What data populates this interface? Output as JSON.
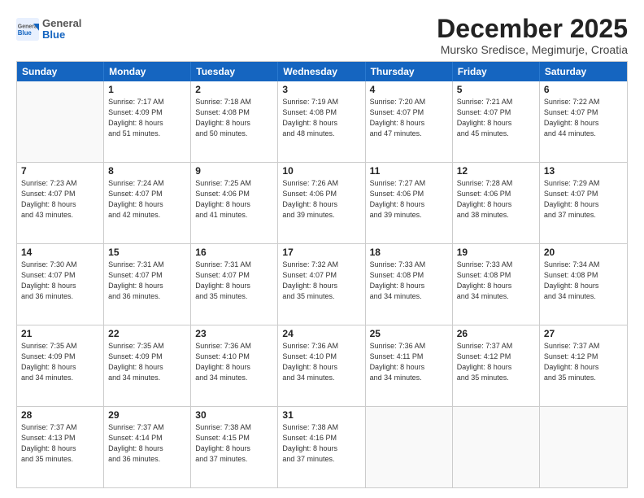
{
  "header": {
    "logo": {
      "general": "General",
      "blue": "Blue"
    },
    "title": "December 2025",
    "subtitle": "Mursko Sredisce, Megimurje, Croatia"
  },
  "calendar": {
    "days": [
      "Sunday",
      "Monday",
      "Tuesday",
      "Wednesday",
      "Thursday",
      "Friday",
      "Saturday"
    ],
    "rows": [
      [
        {
          "day": "",
          "info": ""
        },
        {
          "day": "1",
          "info": "Sunrise: 7:17 AM\nSunset: 4:09 PM\nDaylight: 8 hours\nand 51 minutes."
        },
        {
          "day": "2",
          "info": "Sunrise: 7:18 AM\nSunset: 4:08 PM\nDaylight: 8 hours\nand 50 minutes."
        },
        {
          "day": "3",
          "info": "Sunrise: 7:19 AM\nSunset: 4:08 PM\nDaylight: 8 hours\nand 48 minutes."
        },
        {
          "day": "4",
          "info": "Sunrise: 7:20 AM\nSunset: 4:07 PM\nDaylight: 8 hours\nand 47 minutes."
        },
        {
          "day": "5",
          "info": "Sunrise: 7:21 AM\nSunset: 4:07 PM\nDaylight: 8 hours\nand 45 minutes."
        },
        {
          "day": "6",
          "info": "Sunrise: 7:22 AM\nSunset: 4:07 PM\nDaylight: 8 hours\nand 44 minutes."
        }
      ],
      [
        {
          "day": "7",
          "info": "Sunrise: 7:23 AM\nSunset: 4:07 PM\nDaylight: 8 hours\nand 43 minutes."
        },
        {
          "day": "8",
          "info": "Sunrise: 7:24 AM\nSunset: 4:07 PM\nDaylight: 8 hours\nand 42 minutes."
        },
        {
          "day": "9",
          "info": "Sunrise: 7:25 AM\nSunset: 4:06 PM\nDaylight: 8 hours\nand 41 minutes."
        },
        {
          "day": "10",
          "info": "Sunrise: 7:26 AM\nSunset: 4:06 PM\nDaylight: 8 hours\nand 39 minutes."
        },
        {
          "day": "11",
          "info": "Sunrise: 7:27 AM\nSunset: 4:06 PM\nDaylight: 8 hours\nand 39 minutes."
        },
        {
          "day": "12",
          "info": "Sunrise: 7:28 AM\nSunset: 4:06 PM\nDaylight: 8 hours\nand 38 minutes."
        },
        {
          "day": "13",
          "info": "Sunrise: 7:29 AM\nSunset: 4:07 PM\nDaylight: 8 hours\nand 37 minutes."
        }
      ],
      [
        {
          "day": "14",
          "info": "Sunrise: 7:30 AM\nSunset: 4:07 PM\nDaylight: 8 hours\nand 36 minutes."
        },
        {
          "day": "15",
          "info": "Sunrise: 7:31 AM\nSunset: 4:07 PM\nDaylight: 8 hours\nand 36 minutes."
        },
        {
          "day": "16",
          "info": "Sunrise: 7:31 AM\nSunset: 4:07 PM\nDaylight: 8 hours\nand 35 minutes."
        },
        {
          "day": "17",
          "info": "Sunrise: 7:32 AM\nSunset: 4:07 PM\nDaylight: 8 hours\nand 35 minutes."
        },
        {
          "day": "18",
          "info": "Sunrise: 7:33 AM\nSunset: 4:08 PM\nDaylight: 8 hours\nand 34 minutes."
        },
        {
          "day": "19",
          "info": "Sunrise: 7:33 AM\nSunset: 4:08 PM\nDaylight: 8 hours\nand 34 minutes."
        },
        {
          "day": "20",
          "info": "Sunrise: 7:34 AM\nSunset: 4:08 PM\nDaylight: 8 hours\nand 34 minutes."
        }
      ],
      [
        {
          "day": "21",
          "info": "Sunrise: 7:35 AM\nSunset: 4:09 PM\nDaylight: 8 hours\nand 34 minutes."
        },
        {
          "day": "22",
          "info": "Sunrise: 7:35 AM\nSunset: 4:09 PM\nDaylight: 8 hours\nand 34 minutes."
        },
        {
          "day": "23",
          "info": "Sunrise: 7:36 AM\nSunset: 4:10 PM\nDaylight: 8 hours\nand 34 minutes."
        },
        {
          "day": "24",
          "info": "Sunrise: 7:36 AM\nSunset: 4:10 PM\nDaylight: 8 hours\nand 34 minutes."
        },
        {
          "day": "25",
          "info": "Sunrise: 7:36 AM\nSunset: 4:11 PM\nDaylight: 8 hours\nand 34 minutes."
        },
        {
          "day": "26",
          "info": "Sunrise: 7:37 AM\nSunset: 4:12 PM\nDaylight: 8 hours\nand 35 minutes."
        },
        {
          "day": "27",
          "info": "Sunrise: 7:37 AM\nSunset: 4:12 PM\nDaylight: 8 hours\nand 35 minutes."
        }
      ],
      [
        {
          "day": "28",
          "info": "Sunrise: 7:37 AM\nSunset: 4:13 PM\nDaylight: 8 hours\nand 35 minutes."
        },
        {
          "day": "29",
          "info": "Sunrise: 7:37 AM\nSunset: 4:14 PM\nDaylight: 8 hours\nand 36 minutes."
        },
        {
          "day": "30",
          "info": "Sunrise: 7:38 AM\nSunset: 4:15 PM\nDaylight: 8 hours\nand 37 minutes."
        },
        {
          "day": "31",
          "info": "Sunrise: 7:38 AM\nSunset: 4:16 PM\nDaylight: 8 hours\nand 37 minutes."
        },
        {
          "day": "",
          "info": ""
        },
        {
          "day": "",
          "info": ""
        },
        {
          "day": "",
          "info": ""
        }
      ]
    ]
  }
}
